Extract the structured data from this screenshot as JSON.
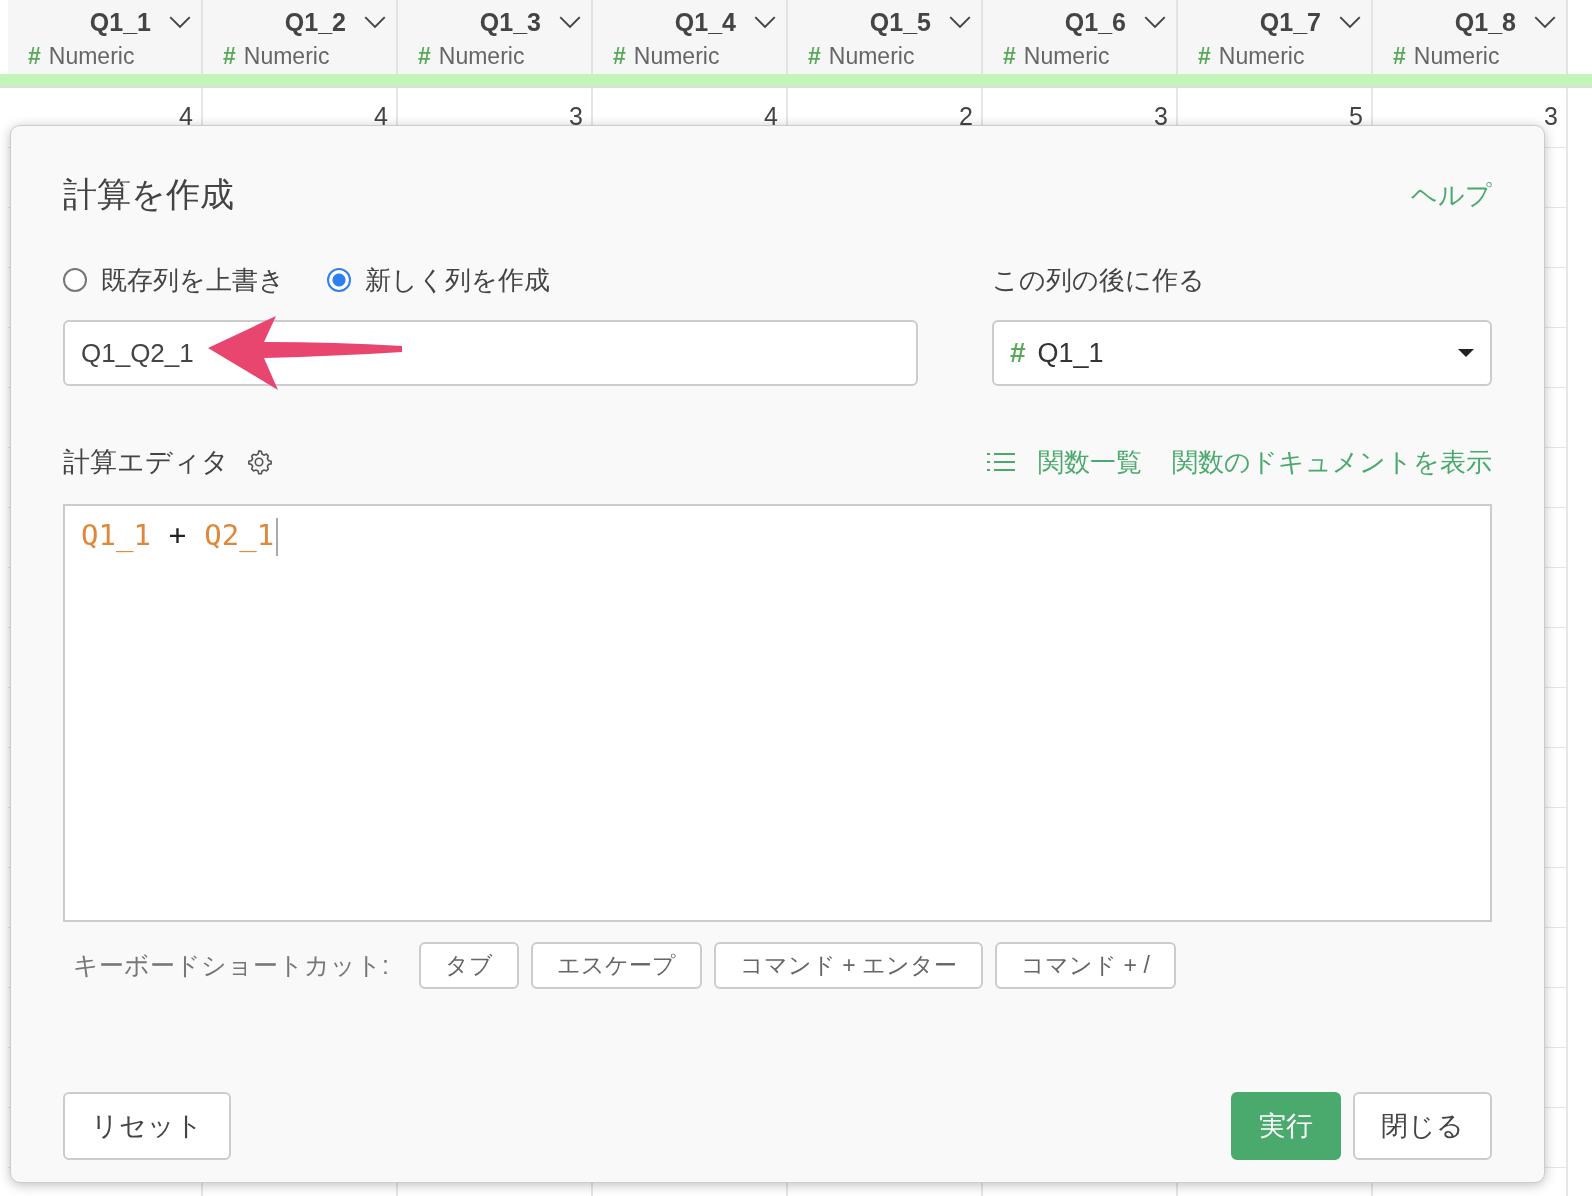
{
  "table": {
    "columns": [
      {
        "name": "Q1_1",
        "type": "Numeric",
        "type_icon": "#",
        "first_value": "4"
      },
      {
        "name": "Q1_2",
        "type": "Numeric",
        "type_icon": "#",
        "first_value": "4"
      },
      {
        "name": "Q1_3",
        "type": "Numeric",
        "type_icon": "#",
        "first_value": "3"
      },
      {
        "name": "Q1_4",
        "type": "Numeric",
        "type_icon": "#",
        "first_value": "4"
      },
      {
        "name": "Q1_5",
        "type": "Numeric",
        "type_icon": "#",
        "first_value": "2"
      },
      {
        "name": "Q1_6",
        "type": "Numeric",
        "type_icon": "#",
        "first_value": "3"
      },
      {
        "name": "Q1_7",
        "type": "Numeric",
        "type_icon": "#",
        "first_value": "5"
      },
      {
        "name": "Q1_8",
        "type": "Numeric",
        "type_icon": "#",
        "first_value": "3"
      }
    ]
  },
  "dialog": {
    "title": "計算を作成",
    "help": "ヘルプ",
    "modes": [
      {
        "label": "既存列を上書き",
        "selected": false
      },
      {
        "label": "新しく列を作成",
        "selected": true
      }
    ],
    "name_value": "Q1_Q2_1",
    "position_label": "この列の後に作る",
    "position": {
      "type_icon": "#",
      "value": "Q1_1"
    },
    "editor_label": "計算エディタ",
    "function_list": "関数一覧",
    "function_docs": "関数のドキュメントを表示",
    "code": [
      {
        "kind": "field",
        "text": "Q1_1"
      },
      {
        "kind": "operator",
        "text": "+"
      },
      {
        "kind": "field",
        "text": "Q2_1"
      }
    ],
    "shortcuts_label": "キーボードショートカット:",
    "shortcuts": [
      "タブ",
      "エスケープ",
      "コマンド + エンター",
      "コマンド + /"
    ],
    "reset": "リセット",
    "run": "実行",
    "close": "閉じる"
  }
}
